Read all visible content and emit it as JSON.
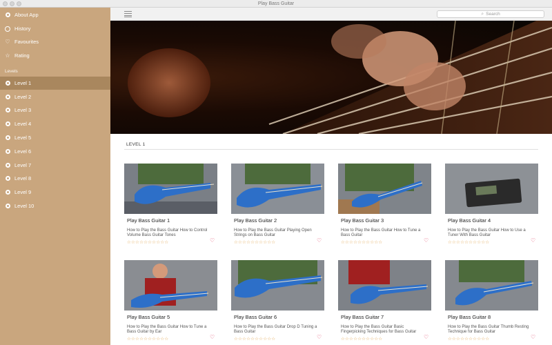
{
  "window": {
    "title": "Play Bass Guitar"
  },
  "sidebar": {
    "menu": [
      {
        "label": "About App",
        "icon": "info-icon"
      },
      {
        "label": "History",
        "icon": "clock-icon"
      },
      {
        "label": "Favourites",
        "icon": "heart-icon"
      },
      {
        "label": "Rating",
        "icon": "star-icon"
      }
    ],
    "section_label": "Levels",
    "levels": [
      {
        "label": "Level 1",
        "active": true
      },
      {
        "label": "Level 2"
      },
      {
        "label": "Level 3"
      },
      {
        "label": "Level 4"
      },
      {
        "label": "Level 5"
      },
      {
        "label": "Level 6"
      },
      {
        "label": "Level 7"
      },
      {
        "label": "Level 8"
      },
      {
        "label": "Level 9"
      },
      {
        "label": "Level 10"
      }
    ]
  },
  "toolbar": {
    "search_placeholder": "Search"
  },
  "content": {
    "heading": "LEVEL 1",
    "rating_stars": "☆☆☆☆☆☆☆☆☆☆",
    "videos": [
      {
        "title": "Play Bass Guitar 1",
        "desc": "How to Play the Bass Guitar  How to Control Volume  Bass Guitar Tones"
      },
      {
        "title": "Play Bass Guitar 2",
        "desc": "How to Play the Bass Guitar  Playing Open Strings on Bass Guitar"
      },
      {
        "title": "Play Bass Guitar 3",
        "desc": "How to Play the Bass Guitar  How to Tune a Bass Guitar"
      },
      {
        "title": "Play Bass Guitar 4",
        "desc": "How to Play the Bass Guitar  How to Use a Tuner With Bass Guitar"
      },
      {
        "title": "Play Bass Guitar 5",
        "desc": "How to Play the Bass Guitar  How to Tune a Bass Guitar by Ear"
      },
      {
        "title": "Play Bass Guitar 6",
        "desc": "How to Play the Bass Guitar  Drop D Tuning a Bass Guitar"
      },
      {
        "title": "Play Bass Guitar 7",
        "desc": "How to Play the Bass Guitar  Basic Fingerpicking Techniques for Bass Guitar"
      },
      {
        "title": "Play Bass Guitar 8",
        "desc": "How to Play the Bass Guitar  Thumb Resting Technique for Bass Guitar"
      }
    ]
  },
  "colors": {
    "sidebar": "#c9a67e",
    "sidebar_active": "#a9875e",
    "star": "#e0a24a",
    "heart": "#e04a6a"
  }
}
